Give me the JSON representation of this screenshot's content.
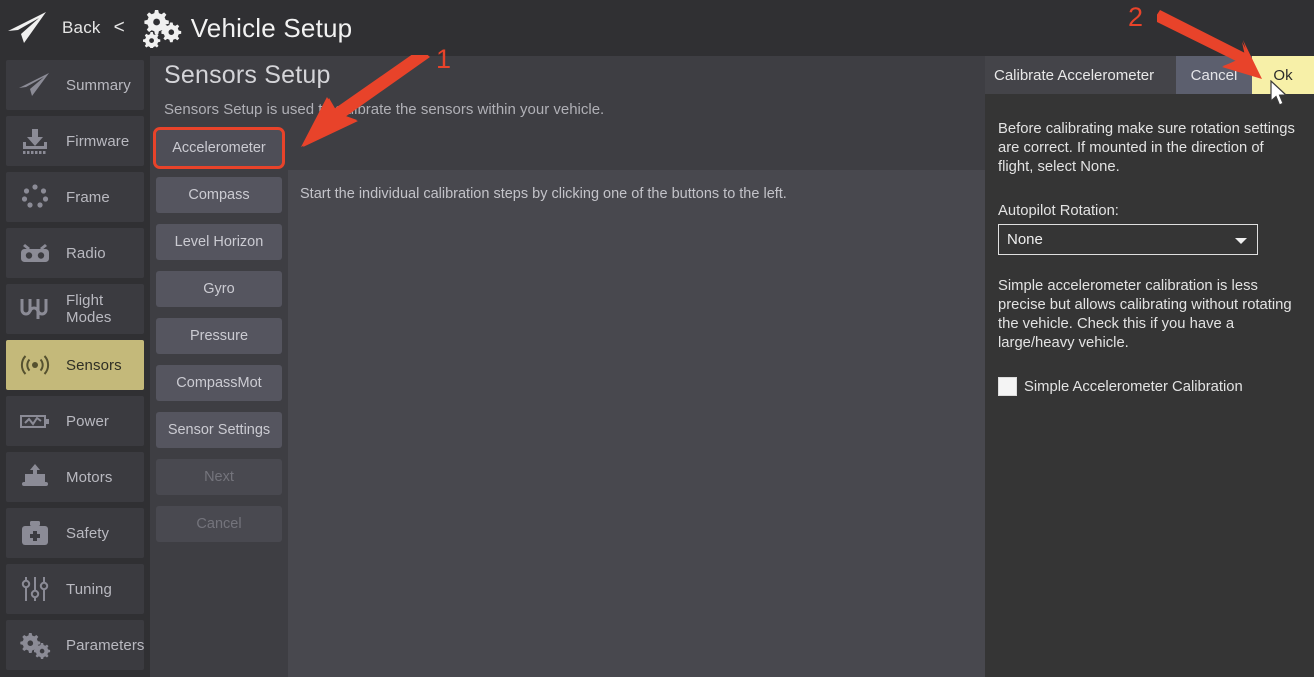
{
  "header": {
    "logo_icon": "paper-plane-icon",
    "back_label": "Back",
    "back_chevron": "<",
    "settings_icon": "gears-icon",
    "title": "Vehicle Setup"
  },
  "sidebar": {
    "items": [
      {
        "label": "Summary",
        "icon": "paper-plane-icon",
        "active": false
      },
      {
        "label": "Firmware",
        "icon": "download-chip-icon",
        "active": false
      },
      {
        "label": "Frame",
        "icon": "frame-dots-icon",
        "active": false
      },
      {
        "label": "Radio",
        "icon": "radio-controller-icon",
        "active": false
      },
      {
        "label": "Flight Modes",
        "icon": "waveform-icon",
        "active": false
      },
      {
        "label": "Sensors",
        "icon": "sensor-signal-icon",
        "active": true
      },
      {
        "label": "Power",
        "icon": "battery-icon",
        "active": false
      },
      {
        "label": "Motors",
        "icon": "motor-icon",
        "active": false
      },
      {
        "label": "Safety",
        "icon": "first-aid-kit-icon",
        "active": false
      },
      {
        "label": "Tuning",
        "icon": "sliders-icon",
        "active": false
      },
      {
        "label": "Parameters",
        "icon": "gears-icon",
        "active": false
      }
    ]
  },
  "main": {
    "title": "Sensors Setup",
    "subtitle": "Sensors Setup is used to calibrate the sensors within your vehicle.",
    "info_text": "Start the individual calibration steps by clicking one of the buttons to the left.",
    "buttons": [
      {
        "label": "Accelerometer",
        "state": "highlighted"
      },
      {
        "label": "Compass",
        "state": "normal"
      },
      {
        "label": "Level Horizon",
        "state": "normal"
      },
      {
        "label": "Gyro",
        "state": "normal"
      },
      {
        "label": "Pressure",
        "state": "normal"
      },
      {
        "label": "CompassMot",
        "state": "normal"
      },
      {
        "label": "Sensor Settings",
        "state": "normal"
      },
      {
        "label": "Next",
        "state": "disabled"
      },
      {
        "label": "Cancel",
        "state": "disabled"
      }
    ]
  },
  "right_panel": {
    "title": "Calibrate Accelerometer",
    "cancel_label": "Cancel",
    "ok_label": "Ok",
    "paragraph_1": "Before calibrating make sure rotation settings are correct. If mounted in the direction of flight, select None.",
    "rotation_label": "Autopilot Rotation:",
    "rotation_value": "None",
    "paragraph_2": "Simple accelerometer calibration is less precise but allows calibrating without rotating the vehicle. Check this if you have a large/heavy vehicle.",
    "checkbox_label": "Simple Accelerometer Calibration",
    "checkbox_checked": false
  },
  "annotations": {
    "step_1": "1",
    "step_2": "2",
    "color": "#e8432a"
  },
  "colors": {
    "accent_highlight": "#c4b97a",
    "ok_button": "#f7f0a8",
    "cancel_button": "#5c5f6e",
    "annotation_red": "#e8432a",
    "main_bg": "#3e3e43",
    "panel_bg": "#353535",
    "sidebar_bg": "#303033"
  }
}
